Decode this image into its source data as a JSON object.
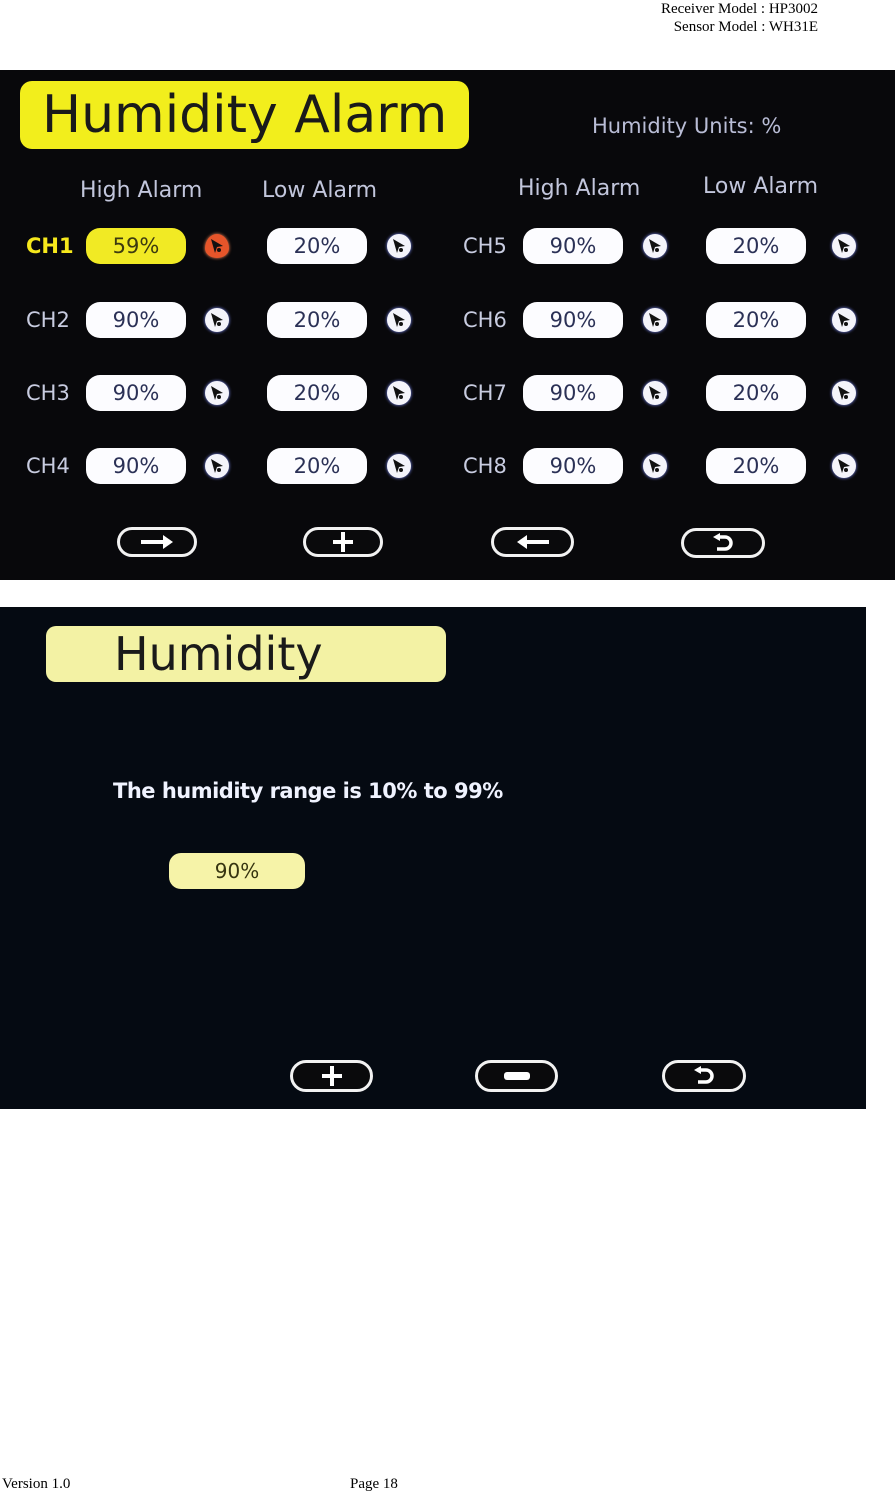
{
  "page_header": {
    "receiver_model": "Receiver Model : HP3002",
    "sensor_model": "Sensor Model : WH31E"
  },
  "screen1": {
    "title": "Humidity Alarm",
    "units_label": "Humidity Units: %",
    "left_group": {
      "high_header": "High Alarm",
      "low_header": "Low Alarm"
    },
    "right_group": {
      "high_header": "High Alarm",
      "low_header": "Low Alarm"
    },
    "channels": [
      {
        "name": "CH1",
        "high": "59%",
        "low": "20%",
        "active": true
      },
      {
        "name": "CH2",
        "high": "90%",
        "low": "20%",
        "active": false
      },
      {
        "name": "CH3",
        "high": "90%",
        "low": "20%",
        "active": false
      },
      {
        "name": "CH4",
        "high": "90%",
        "low": "20%",
        "active": false
      },
      {
        "name": "CH5",
        "high": "90%",
        "low": "20%",
        "active": false
      },
      {
        "name": "CH6",
        "high": "90%",
        "low": "20%",
        "active": false
      },
      {
        "name": "CH7",
        "high": "90%",
        "low": "20%",
        "active": false
      },
      {
        "name": "CH8",
        "high": "90%",
        "low": "20%",
        "active": false
      }
    ],
    "buttons": [
      {
        "icon": "arrow-right-icon",
        "action": "next"
      },
      {
        "icon": "plus-icon",
        "action": "increase"
      },
      {
        "icon": "arrow-left-icon",
        "action": "previous"
      },
      {
        "icon": "return-icon",
        "action": "back"
      }
    ],
    "colors": {
      "title_bg": "#f2ee1c",
      "active_value_bg": "#f1ea24",
      "active_alarm_icon": "#e6552a",
      "background": "#08080b"
    }
  },
  "screen2": {
    "title": "Humidity",
    "range_text": "The humidity range is 10% to 99%",
    "value": "90%",
    "buttons": [
      {
        "icon": "plus-icon",
        "action": "increase"
      },
      {
        "icon": "minus-icon",
        "action": "decrease"
      },
      {
        "icon": "return-icon",
        "action": "back"
      }
    ],
    "colors": {
      "title_bg": "#f3f2a4",
      "value_bg": "#f6f3a8",
      "background": "#050a12"
    }
  },
  "page_footer": {
    "version": "Version 1.0",
    "page": "Page 18"
  }
}
